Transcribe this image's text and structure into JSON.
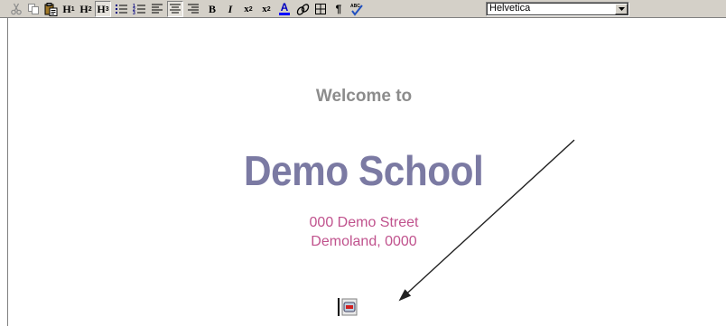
{
  "toolbar": {
    "buttons": [
      {
        "name": "cut-button",
        "icon": "scissors-icon",
        "state": "disabled"
      },
      {
        "name": "copy-button",
        "icon": "copy-icon",
        "state": "disabled"
      },
      {
        "name": "paste-button",
        "icon": "paste-icon",
        "state": "enabled"
      },
      {
        "name": "heading1-button",
        "label": "H",
        "sub": "1"
      },
      {
        "name": "heading2-button",
        "label": "H",
        "sub": "2"
      },
      {
        "name": "heading3-button",
        "label": "H",
        "sub": "3",
        "state": "pressed"
      },
      {
        "name": "bullet-list-button",
        "icon": "bullet-list-icon"
      },
      {
        "name": "numbered-list-button",
        "icon": "numbered-list-icon"
      },
      {
        "name": "align-left-button",
        "icon": "align-left-icon"
      },
      {
        "name": "align-center-button",
        "icon": "align-center-icon",
        "state": "pressed"
      },
      {
        "name": "align-right-button",
        "icon": "align-right-icon"
      },
      {
        "name": "bold-button",
        "label": "B"
      },
      {
        "name": "italic-button",
        "label": "I"
      },
      {
        "name": "subscript-button",
        "label": "x",
        "sub": "2"
      },
      {
        "name": "superscript-button",
        "label": "x",
        "sup": "2"
      },
      {
        "name": "text-color-button",
        "label": "A",
        "icon": "text-color-icon"
      },
      {
        "name": "link-button",
        "icon": "link-icon"
      },
      {
        "name": "table-button",
        "icon": "table-icon"
      },
      {
        "name": "paragraph-marks-button",
        "label": "¶"
      },
      {
        "name": "spellcheck-button",
        "label": "ABC",
        "icon": "spellcheck-icon"
      }
    ],
    "font_select": {
      "value": "Helvetica"
    }
  },
  "document": {
    "welcome": "Welcome to",
    "school_name": "Demo School",
    "address_line1": "000 Demo Street",
    "address_line2": "Demoland, 0000"
  },
  "colors": {
    "welcome": "#8c8c8c",
    "school_name": "#7b7aa3",
    "address": "#c0528d",
    "toolbar_bg": "#d4d0c8"
  }
}
